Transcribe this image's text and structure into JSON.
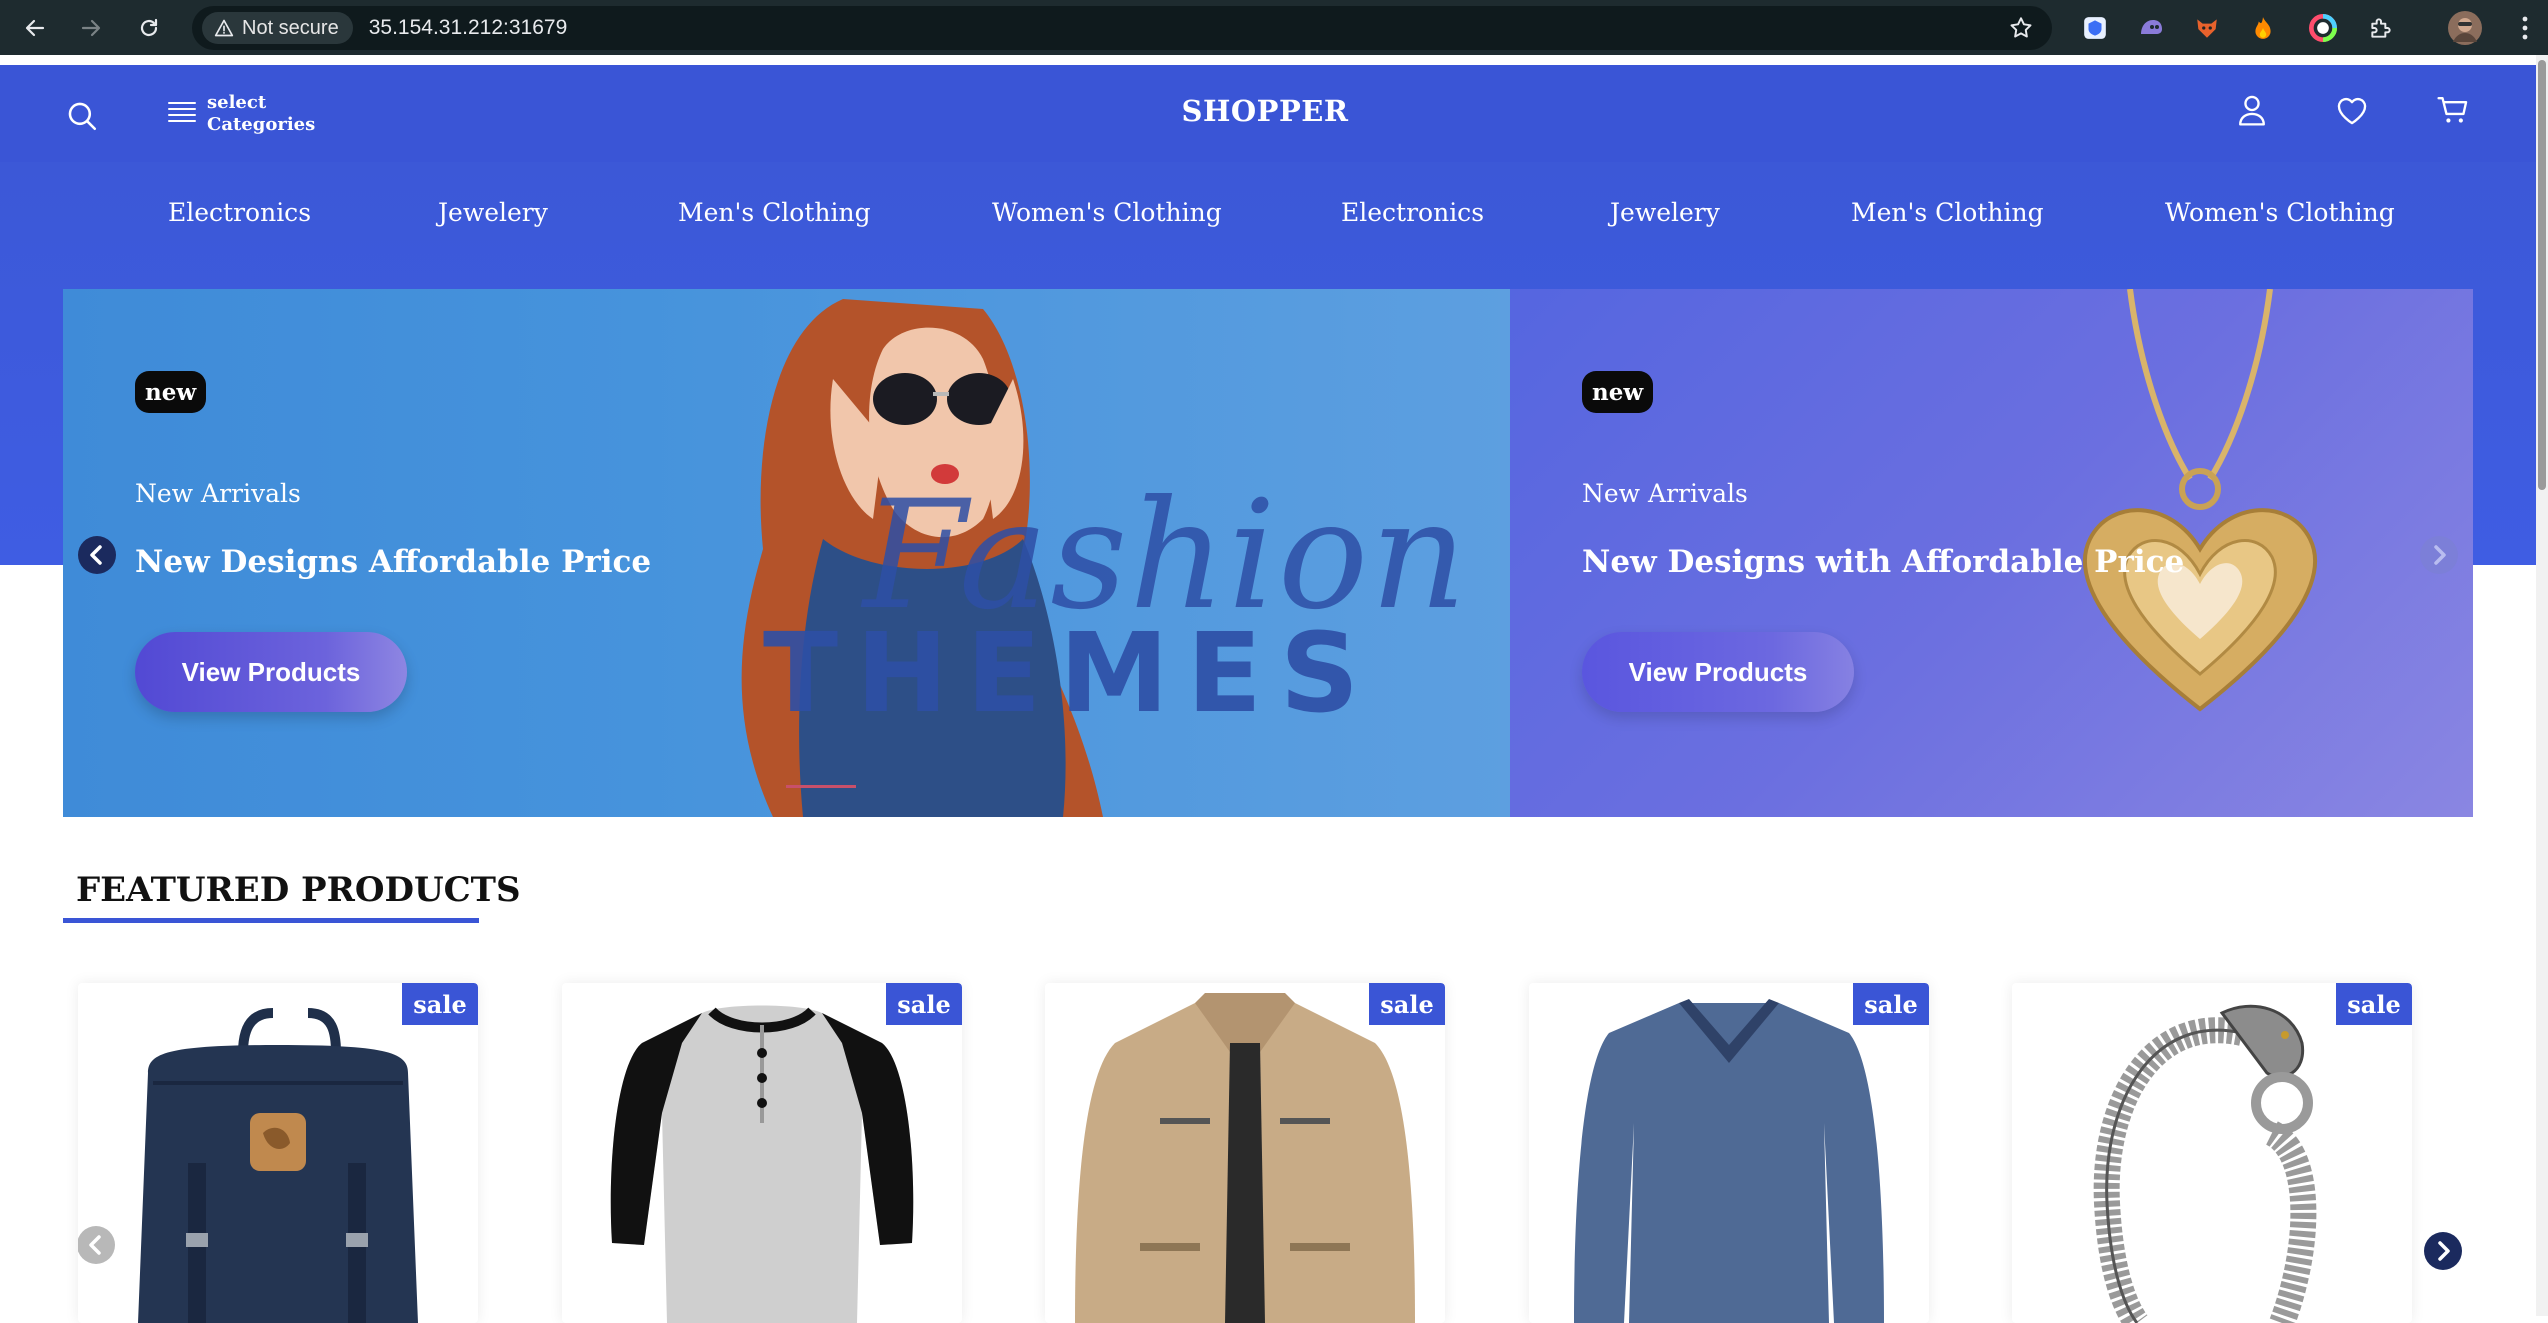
{
  "browser": {
    "security_label": "Not secure",
    "url": "35.154.31.212:31679"
  },
  "header": {
    "category_line1": "select",
    "category_line2": "Categories",
    "logo": "SHOPPER"
  },
  "categories": [
    "Electronics",
    "Jewelery",
    "Men's Clothing",
    "Women's Clothing",
    "Electronics",
    "Jewelery",
    "Men's Clothing",
    "Women's Clothing"
  ],
  "slides": [
    {
      "badge": "new",
      "subtitle": "New Arrivals",
      "title": "New Designs Affordable Price",
      "button": "View Products",
      "art_word1": "Fashion",
      "art_word2": "THEMES"
    },
    {
      "badge": "new",
      "subtitle": "New Arrivals",
      "title": "New Designs with Affordable Price",
      "button": "View Products"
    }
  ],
  "featured": {
    "title": "FEATURED PRODUCTS",
    "sale_label": "sale",
    "products": [
      {
        "name": "backpack",
        "sale": "sale"
      },
      {
        "name": "henley-shirt",
        "sale": "sale"
      },
      {
        "name": "jacket",
        "sale": "sale"
      },
      {
        "name": "v-neck-tshirt",
        "sale": "sale"
      },
      {
        "name": "dragon-bracelet",
        "sale": "sale"
      }
    ]
  },
  "colors": {
    "brand": "#3a55d6",
    "slide1_bg": "#4693dc",
    "slide2_bg": "#6b6fe0"
  }
}
